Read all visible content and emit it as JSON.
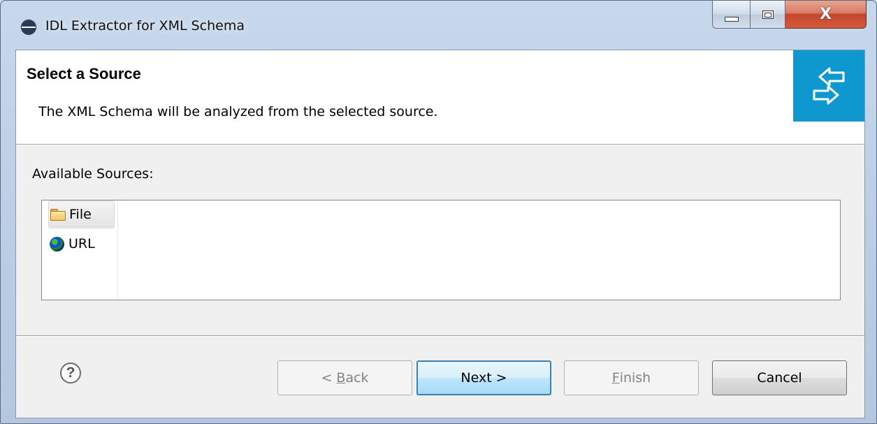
{
  "window": {
    "title": "IDL Extractor for XML Schema",
    "icon": "eclipse-icon",
    "controls": {
      "minimize": "minimize-icon",
      "maximize": "maximize-icon",
      "close": "close-icon",
      "close_glyph": "X"
    }
  },
  "header": {
    "title": "Select a Source",
    "description": "The XML Schema will be analyzed from the selected source.",
    "icon": "import-arrows-icon",
    "icon_color": "#0f97cf"
  },
  "sources": {
    "label": "Available Sources:",
    "items": [
      {
        "label": "File",
        "icon": "folder-icon",
        "selected": true
      },
      {
        "label": "URL",
        "icon": "globe-icon",
        "selected": false
      }
    ]
  },
  "buttons": {
    "help": "?",
    "back": {
      "prefix": "< ",
      "mnemonic": "B",
      "rest": "ack",
      "enabled": false
    },
    "next": {
      "label": "Next >",
      "enabled": true,
      "default": true
    },
    "finish": {
      "mnemonic": "F",
      "rest": "inish",
      "enabled": false
    },
    "cancel": {
      "label": "Cancel",
      "enabled": true
    }
  }
}
